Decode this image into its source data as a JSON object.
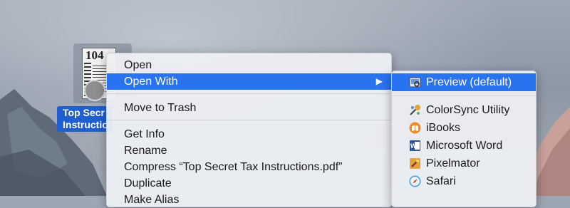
{
  "desktop": {
    "file_icon_label": "Top Secret Tax Instructions",
    "file_icon_label_line1": "Top Secr",
    "file_icon_label_line2": "Instructio",
    "thumb_text": "104"
  },
  "context_menu": {
    "items": [
      {
        "label": "Open"
      },
      {
        "label": "Open With",
        "selected": true,
        "submenu_arrow": "▶"
      },
      {
        "label": "Move to Trash"
      },
      {
        "label": "Get Info"
      },
      {
        "label": "Rename"
      },
      {
        "label": "Compress “Top Secret Tax Instructions.pdf”"
      },
      {
        "label": "Duplicate"
      },
      {
        "label": "Make Alias"
      }
    ]
  },
  "open_with_submenu": {
    "items": [
      {
        "label": "Preview (default)",
        "icon": "preview-icon",
        "selected": true
      },
      {
        "label": "ColorSync Utility",
        "icon": "colorsync-icon"
      },
      {
        "label": "iBooks",
        "icon": "ibooks-icon"
      },
      {
        "label": "Microsoft Word",
        "icon": "word-icon"
      },
      {
        "label": "Pixelmator",
        "icon": "pixelmator-icon"
      },
      {
        "label": "Safari",
        "icon": "safari-icon"
      }
    ]
  },
  "colors": {
    "selection": "#2a73f0",
    "label_highlight": "#1f5fd1",
    "menu_bg": "#eceef2"
  }
}
